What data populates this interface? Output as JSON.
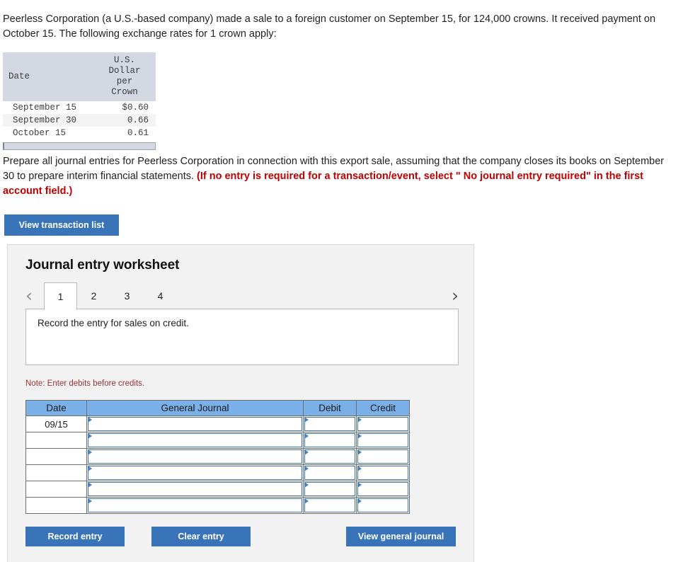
{
  "intro": {
    "text": "Peerless Corporation (a U.S.-based company) made a sale to a foreign customer on September 15, for 124,000 crowns. It received payment on October 15. The following exchange rates for 1 crown apply:"
  },
  "rate_table": {
    "headers": [
      "Date",
      "U.S. Dollar per Crown"
    ],
    "header_date": "Date",
    "header_rate_lines": [
      "U.S.",
      "Dollar",
      "per",
      "Crown"
    ],
    "rows": [
      {
        "date": "September 15",
        "rate": "$0.60"
      },
      {
        "date": "September 30",
        "rate": "0.66"
      },
      {
        "date": "October 15",
        "rate": "0.61"
      }
    ]
  },
  "prompt": {
    "part1": "Prepare all journal entries for Peerless Corporation in connection with this export sale, assuming that the company closes its books on September 30 to prepare interim financial statements. ",
    "highlight": "(If no entry is required for a transaction/event, select \" No journal entry required\" in the first account field.)"
  },
  "buttons": {
    "view_transaction_list": "View transaction list",
    "record_entry": "Record entry",
    "clear_entry": "Clear entry",
    "view_general_journal": "View general journal"
  },
  "worksheet": {
    "title": "Journal entry worksheet",
    "prev_icon": "chevron-left-icon",
    "next_icon": "chevron-right-icon",
    "prev_glyph": "‹",
    "next_glyph": "›",
    "tabs": [
      {
        "label": "1",
        "active": true
      },
      {
        "label": "2",
        "active": false
      },
      {
        "label": "3",
        "active": false
      },
      {
        "label": "4",
        "active": false
      }
    ],
    "description": "Record the entry for sales on credit.",
    "note": "Note: Enter debits before credits.",
    "journal": {
      "headers": [
        "Date",
        "General Journal",
        "Debit",
        "Credit"
      ],
      "rows": [
        {
          "date": "09/15",
          "general_journal": "",
          "debit": "",
          "credit": ""
        },
        {
          "date": "",
          "general_journal": "",
          "debit": "",
          "credit": ""
        },
        {
          "date": "",
          "general_journal": "",
          "debit": "",
          "credit": ""
        },
        {
          "date": "",
          "general_journal": "",
          "debit": "",
          "credit": ""
        },
        {
          "date": "",
          "general_journal": "",
          "debit": "",
          "credit": ""
        },
        {
          "date": "",
          "general_journal": "",
          "debit": "",
          "credit": ""
        }
      ]
    }
  },
  "colors": {
    "button_blue": "#3a74b8",
    "table_header_blue": "#7ab0e8",
    "rate_header_bg": "#d4d8e2",
    "panel_bg": "#f2f2f2",
    "note_red": "#993333",
    "highlight_red": "#c00000"
  }
}
